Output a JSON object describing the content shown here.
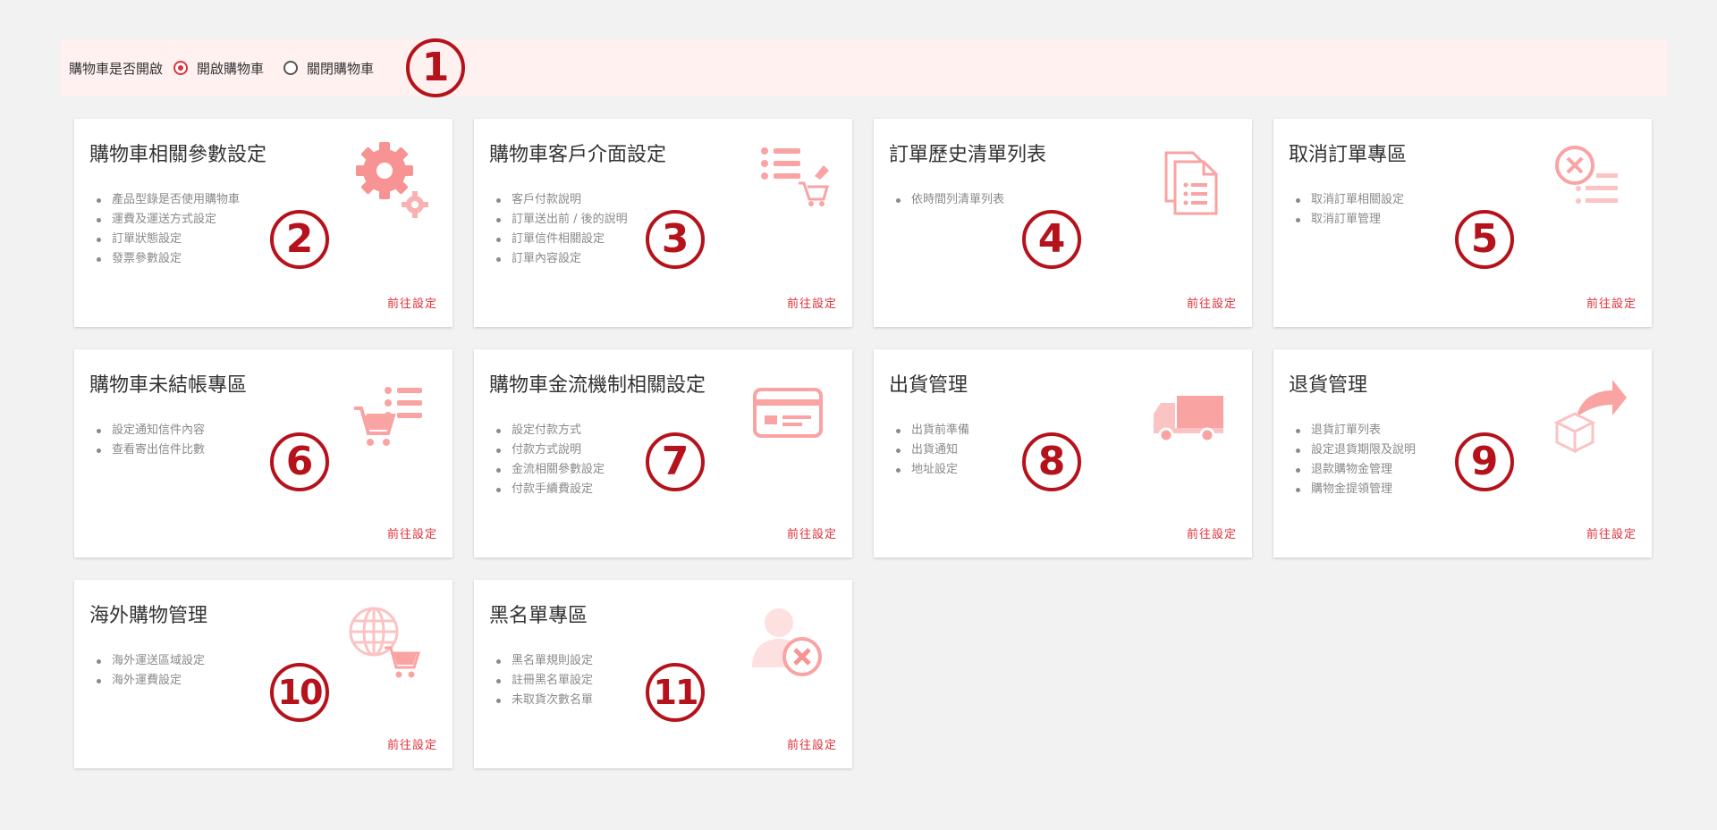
{
  "cart_toggle": {
    "label": "購物車是否開啟",
    "options": [
      {
        "label": "開啟購物車",
        "checked": true
      },
      {
        "label": "關閉購物車",
        "checked": false
      }
    ],
    "badge": "1"
  },
  "link_label": "前往設定",
  "accent_color": "#e0313a",
  "icon_color": "#f7a5a5",
  "badge_color": "#b5121b",
  "cards": [
    {
      "title": "購物車相關參數設定",
      "items": [
        "產品型錄是否使用購物車",
        "運費及運送方式設定",
        "訂單狀態設定",
        "發票參數設定"
      ],
      "icon": "gear-icon",
      "badge": "2"
    },
    {
      "title": "購物車客戶介面設定",
      "items": [
        "客戶付款說明",
        "訂單送出前 / 後的說明",
        "訂單信件相關設定",
        "訂單內容設定"
      ],
      "icon": "list-cart-icon",
      "badge": "3"
    },
    {
      "title": "訂單歷史清單列表",
      "items": [
        "依時間列清單列表"
      ],
      "icon": "documents-icon",
      "badge": "4"
    },
    {
      "title": "取消訂單專區",
      "items": [
        "取消訂單相關設定",
        "取消訂單管理"
      ],
      "icon": "cancel-list-icon",
      "badge": "5"
    },
    {
      "title": "購物車未結帳專區",
      "items": [
        "設定通知信件內容",
        "查看寄出信件比數"
      ],
      "icon": "cart-list-icon",
      "badge": "6"
    },
    {
      "title": "購物車金流機制相關設定",
      "items": [
        "設定付款方式",
        "付款方式說明",
        "金流相關參數設定",
        "付款手續費設定"
      ],
      "icon": "credit-card-icon",
      "badge": "7"
    },
    {
      "title": "出貨管理",
      "items": [
        "出貨前準備",
        "出貨通知",
        "地址設定"
      ],
      "icon": "truck-icon",
      "badge": "8"
    },
    {
      "title": "退貨管理",
      "items": [
        "退貨訂單列表",
        "設定退貨期限及說明",
        "退款購物金管理",
        "購物金提領管理"
      ],
      "icon": "return-box-icon",
      "badge": "9"
    },
    {
      "title": "海外購物管理",
      "items": [
        "海外運送區域設定",
        "海外運費設定"
      ],
      "icon": "globe-cart-icon",
      "badge": "10"
    },
    {
      "title": "黑名單專區",
      "items": [
        "黑名單規則設定",
        "註冊黑名單設定",
        "未取貨次數名單"
      ],
      "icon": "user-block-icon",
      "badge": "11"
    }
  ]
}
